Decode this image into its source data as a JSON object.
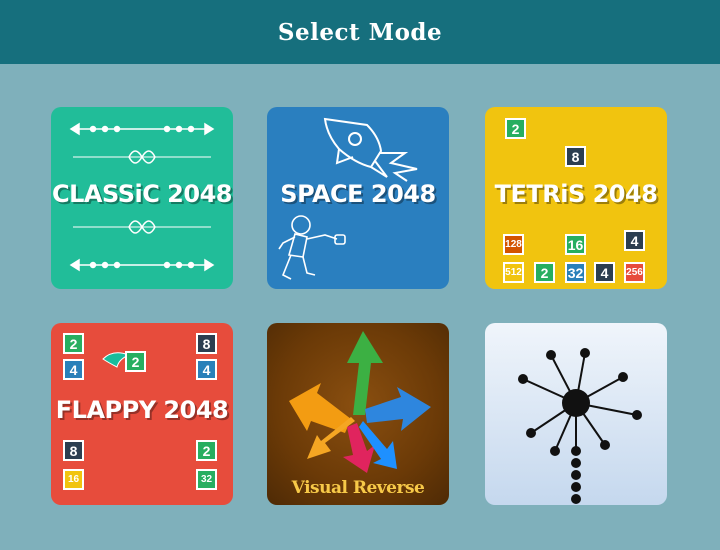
{
  "header": {
    "title": "Select Mode"
  },
  "modes": {
    "classic": {
      "title": "CLASSiC 2048",
      "color": "#21bd99"
    },
    "space": {
      "title": "SPACE 2048",
      "color": "#2a7fbf"
    },
    "tetris": {
      "title": "TETRiS 2048",
      "color": "#f1c40f",
      "tiles": [
        "2",
        "8",
        "128",
        "16",
        "4",
        "512",
        "2",
        "32",
        "4",
        "256"
      ]
    },
    "flappy": {
      "title": "FLAPPY 2048",
      "color": "#e74c3c",
      "tiles": [
        "2",
        "4",
        "2",
        "8",
        "4",
        "8",
        "16",
        "2",
        "32"
      ]
    },
    "visual_reverse": {
      "title": "Visual Reverse",
      "color": "#6b3a07"
    },
    "dots": {
      "color": "#dde8f5"
    }
  }
}
